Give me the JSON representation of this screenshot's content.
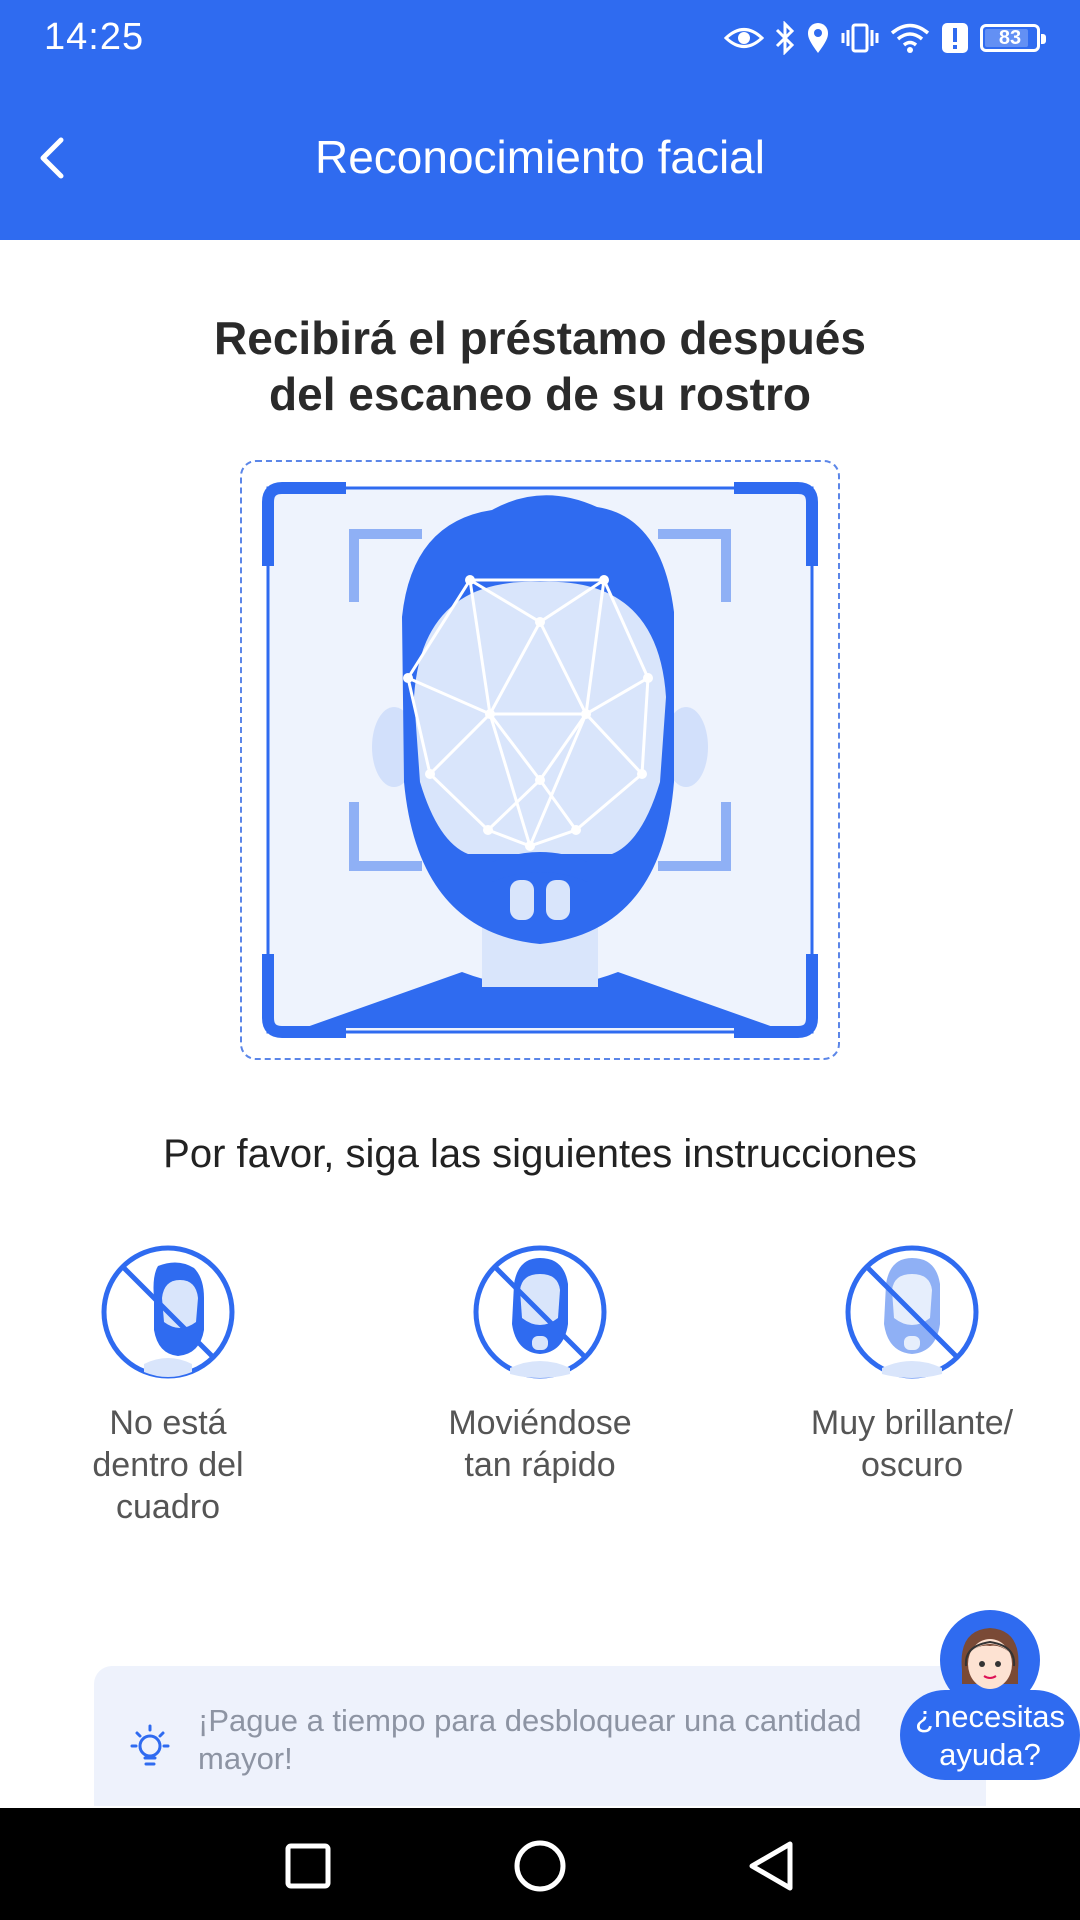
{
  "status_bar": {
    "time": "14:25",
    "battery": "83",
    "icons": [
      "eye-icon",
      "bluetooth-icon",
      "location-icon",
      "vibrate-icon",
      "wifi-icon",
      "alert-icon",
      "battery-icon"
    ]
  },
  "appbar": {
    "title": "Reconocimiento facial",
    "back_icon": "chevron-left-icon"
  },
  "headline": {
    "line1": "Recibirá el préstamo después",
    "line2": "del escaneo de su rostro"
  },
  "instructions": {
    "title": "Por favor, siga las siguientes instrucciones",
    "tips": [
      {
        "line1": "No está",
        "line2": "dentro del",
        "line3": "cuadro",
        "icon": "face-out-of-frame-icon"
      },
      {
        "line1": "Moviéndose",
        "line2": "tan rápido",
        "line3": "",
        "icon": "face-moving-icon"
      },
      {
        "line1": "Muy brillante/",
        "line2": "oscuro",
        "line3": "",
        "icon": "face-lighting-icon"
      }
    ]
  },
  "banner": {
    "icon": "lightbulb-icon",
    "text": "¡Pague a tiempo para desbloquear una cantidad mayor!"
  },
  "help": {
    "line1": "¿necesitas",
    "line2": "ayuda?",
    "icon": "support-agent-avatar"
  },
  "colors": {
    "primary": "#2f6bf0",
    "banner_bg": "#eef2fc",
    "text_dark": "#2a2a2a",
    "text_muted": "#8d94a3"
  }
}
